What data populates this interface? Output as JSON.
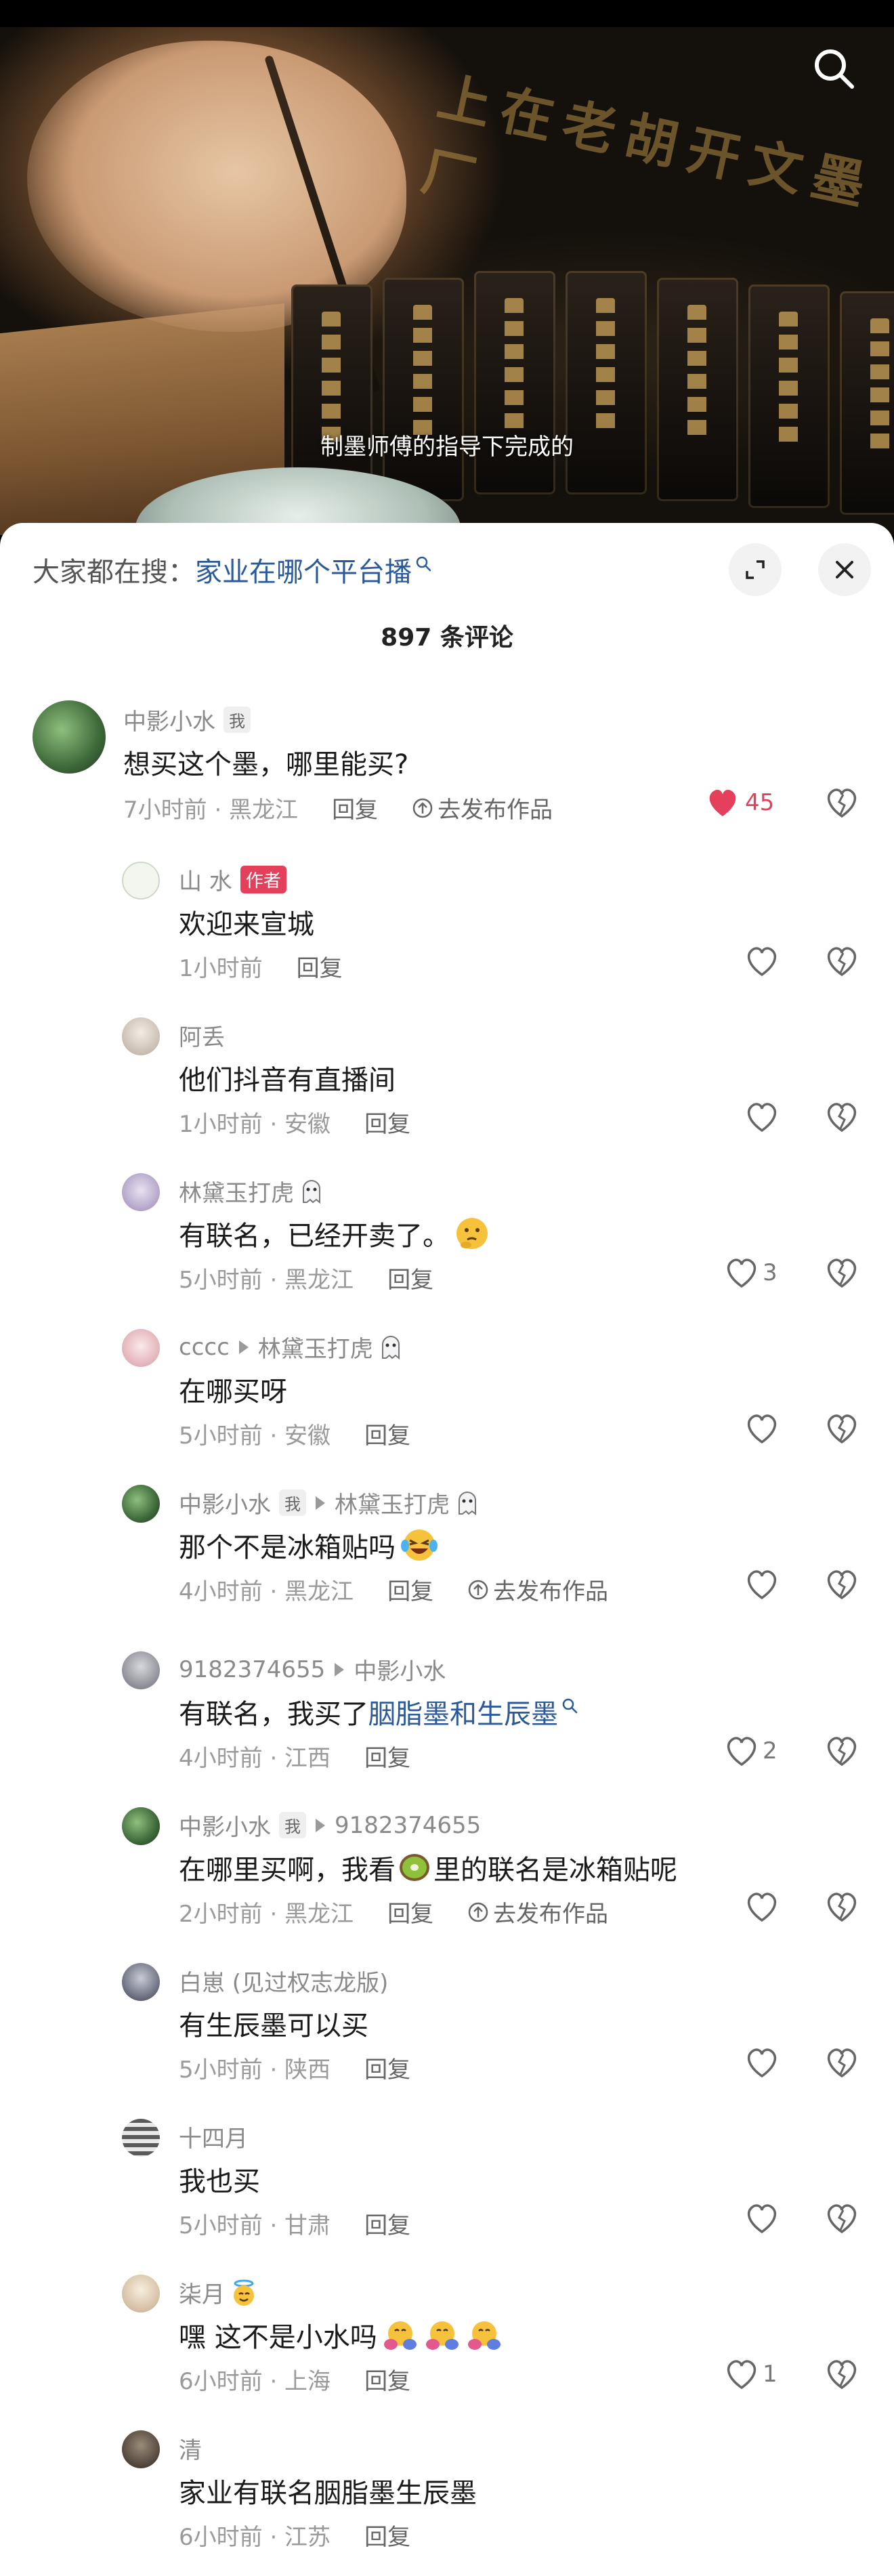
{
  "video": {
    "subtitle": "制墨师傅的指导下完成的",
    "sign_text": "上在老胡开文墨厂"
  },
  "search": {
    "prefix": "大家都在搜：",
    "term": "家业在哪个平台播"
  },
  "comment_count": "897 条评论",
  "comments": [
    {
      "name": "中影小水",
      "me_tag": "我",
      "text": "想买这个墨，哪里能买?",
      "time": "7小时前 · 黑龙江",
      "reply": "回复",
      "publish": "去发布作品",
      "likes": "45",
      "liked": true
    },
    {
      "name": "山 水",
      "author_tag": "作者",
      "text": "欢迎来宣城",
      "time": "1小时前",
      "reply": "回复"
    },
    {
      "name": "阿丢",
      "text": "他们抖音有直播间",
      "time": "1小时前 · 安徽",
      "reply": "回复"
    },
    {
      "name": "林黛玉打虎",
      "text": "有联名，已经开卖了。",
      "time": "5小时前 · 黑龙江",
      "reply": "回复",
      "likes": "3"
    },
    {
      "name": "cccc",
      "reply_to": "林黛玉打虎",
      "text": "在哪买呀",
      "time": "5小时前 · 安徽",
      "reply": "回复"
    },
    {
      "name": "中影小水",
      "me_tag": "我",
      "reply_to": "林黛玉打虎",
      "text": "那个不是冰箱贴吗",
      "time": "4小时前 · 黑龙江",
      "reply": "回复",
      "publish": "去发布作品"
    },
    {
      "name": "9182374655",
      "reply_to": "中影小水",
      "text_a": "有联名，我买了",
      "text_link": "胭脂墨和生辰墨",
      "time": "4小时前 · 江西",
      "reply": "回复",
      "likes": "2"
    },
    {
      "name": "中影小水",
      "me_tag": "我",
      "reply_to": "9182374655",
      "text_a": "在哪里买啊，我看",
      "text_b": "里的联名是冰箱贴呢",
      "time": "2小时前 · 黑龙江",
      "reply": "回复",
      "publish": "去发布作品"
    },
    {
      "name": "白崽 (见过权志龙版)",
      "text": "有生辰墨可以买",
      "time": "5小时前 · 陕西",
      "reply": "回复"
    },
    {
      "name": "十四月",
      "text": "我也买",
      "time": "5小时前 · 甘肃",
      "reply": "回复"
    },
    {
      "name": "柒月",
      "text": "嘿  这不是小水吗",
      "time": "6小时前 · 上海",
      "reply": "回复",
      "likes": "1"
    },
    {
      "name": "清",
      "text": "家业有联名胭脂墨生辰墨",
      "time": "6小时前 · 江苏",
      "reply": "回复"
    }
  ],
  "colors": {
    "accent_red": "#e4405b",
    "link_blue": "#2b5a9a"
  },
  "icons": [
    "search-icon",
    "expand-icon",
    "close-icon",
    "heart-icon",
    "dislike-icon",
    "publish-icon",
    "search-mini-icon"
  ]
}
